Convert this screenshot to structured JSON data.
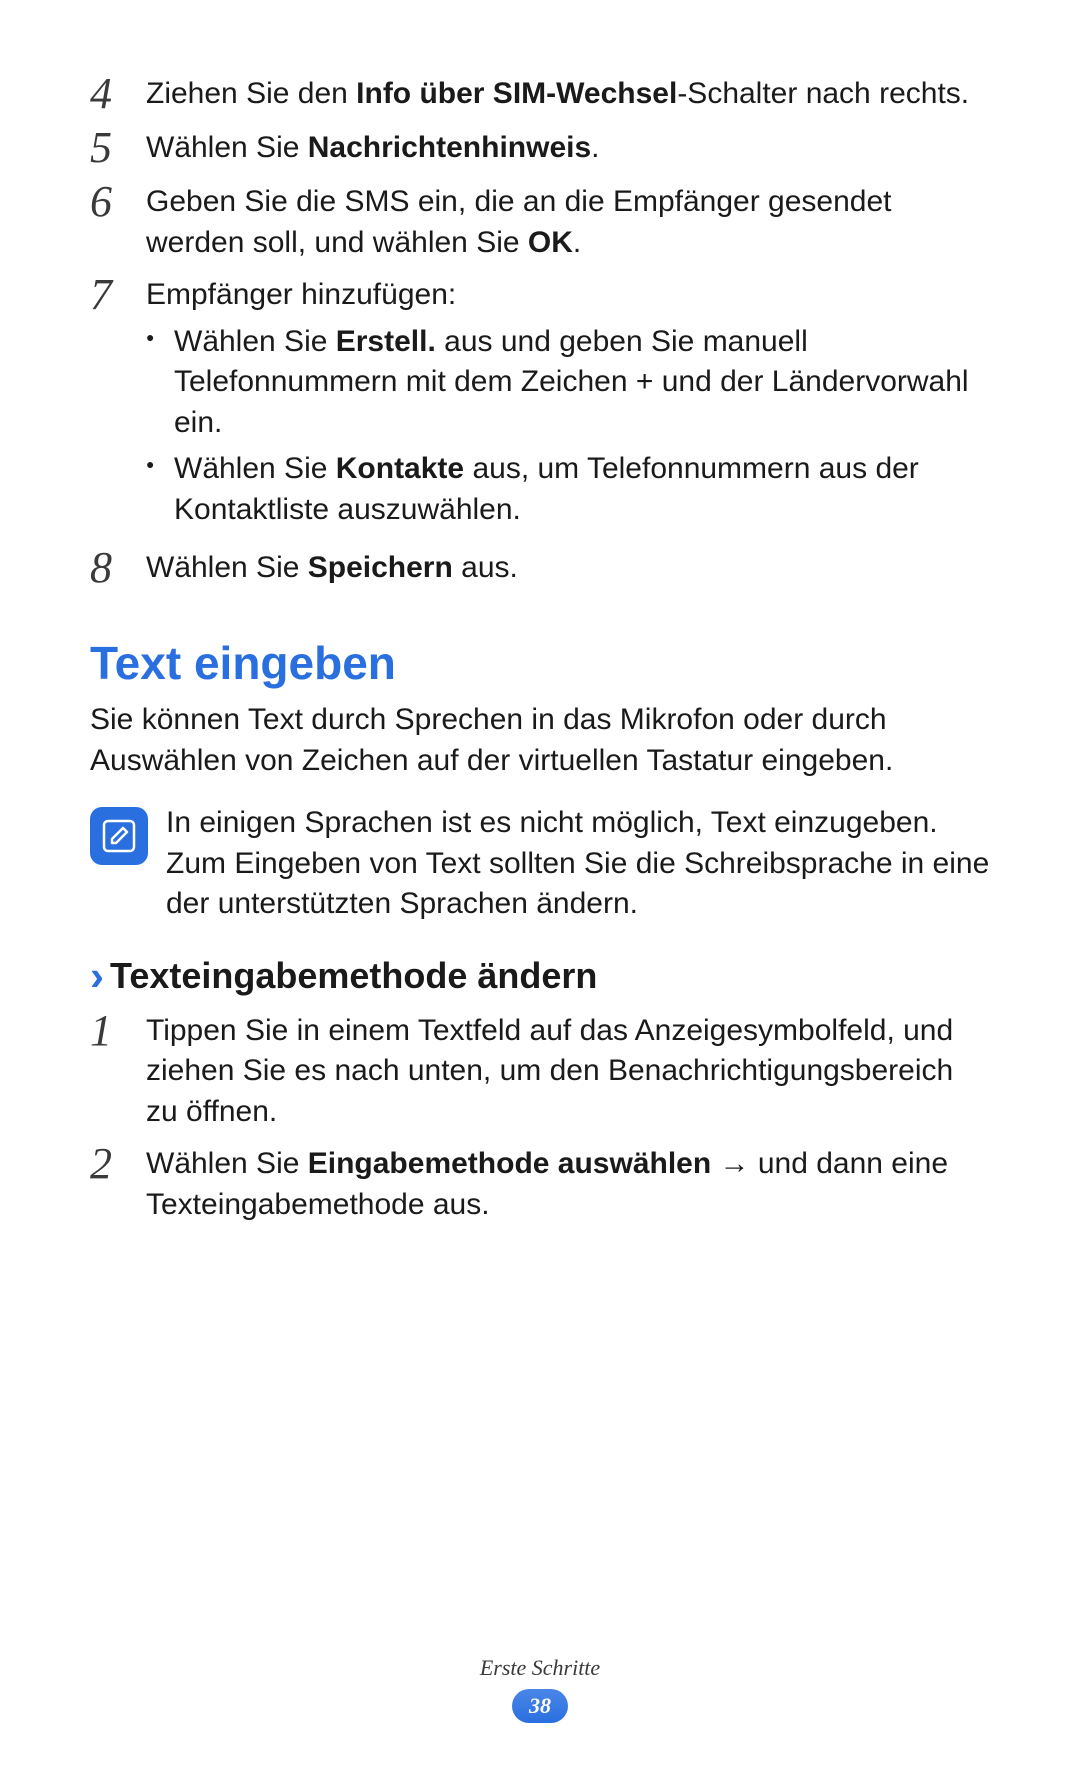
{
  "steps_top": [
    {
      "num": "4",
      "parts": [
        {
          "t": "Ziehen Sie den ",
          "b": false
        },
        {
          "t": "Info über SIM-Wechsel",
          "b": true
        },
        {
          "t": "-Schalter nach rechts.",
          "b": false
        }
      ]
    },
    {
      "num": "5",
      "parts": [
        {
          "t": "Wählen Sie ",
          "b": false
        },
        {
          "t": "Nachrichtenhinweis",
          "b": true
        },
        {
          "t": ".",
          "b": false
        }
      ]
    },
    {
      "num": "6",
      "parts": [
        {
          "t": "Geben Sie die SMS ein, die an die Empfänger gesendet werden soll, und wählen Sie ",
          "b": false
        },
        {
          "t": "OK",
          "b": true
        },
        {
          "t": ".",
          "b": false
        }
      ]
    },
    {
      "num": "7",
      "parts": [
        {
          "t": "Empfänger hinzufügen:",
          "b": false
        }
      ],
      "bullets": [
        [
          {
            "t": "Wählen Sie ",
            "b": false
          },
          {
            "t": "Erstell.",
            "b": true
          },
          {
            "t": " aus und geben Sie manuell Telefonnummern mit dem Zeichen + und der Ländervorwahl ein.",
            "b": false
          }
        ],
        [
          {
            "t": "Wählen Sie ",
            "b": false
          },
          {
            "t": "Kontakte",
            "b": true
          },
          {
            "t": " aus, um Telefonnummern aus der Kontaktliste auszuwählen.",
            "b": false
          }
        ]
      ]
    },
    {
      "num": "8",
      "parts": [
        {
          "t": "Wählen Sie ",
          "b": false
        },
        {
          "t": "Speichern",
          "b": true
        },
        {
          "t": " aus.",
          "b": false
        }
      ]
    }
  ],
  "section_title": "Text eingeben",
  "section_intro": "Sie können Text durch Sprechen in das Mikrofon oder durch Auswählen von Zeichen auf der virtuellen Tastatur eingeben.",
  "note_text": "In einigen Sprachen ist es nicht möglich, Text einzugeben. Zum Eingeben von Text sollten Sie die Schreibsprache in eine der unterstützten Sprachen ändern.",
  "sub_title": "Texteingabemethode ändern",
  "steps_bottom": [
    {
      "num": "1",
      "parts": [
        {
          "t": "Tippen Sie in einem Textfeld auf das Anzeigesymbolfeld, und ziehen Sie es nach unten, um den Benachrichtigungsbereich zu öffnen.",
          "b": false
        }
      ]
    },
    {
      "num": "2",
      "parts": [
        {
          "t": "Wählen Sie ",
          "b": false
        },
        {
          "t": "Eingabemethode auswählen",
          "b": true
        },
        {
          "t": " → und dann eine Texteingabemethode aus.",
          "b": false
        }
      ]
    }
  ],
  "footer": {
    "section": "Erste Schritte",
    "page": "38"
  }
}
